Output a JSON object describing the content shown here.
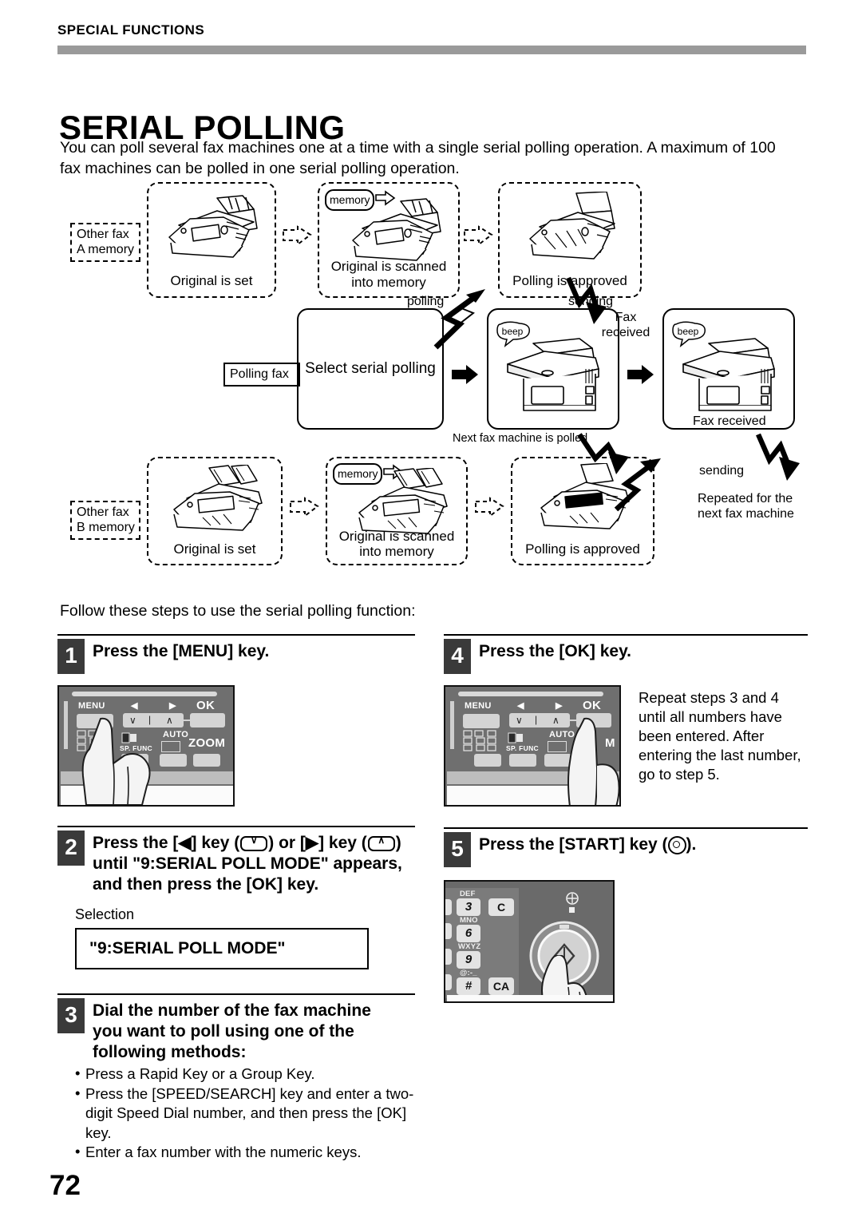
{
  "header": {
    "running_head": "SPECIAL FUNCTIONS"
  },
  "title": "SERIAL POLLING",
  "intro": "You can poll several fax machines one at a time with a single serial polling operation. A maximum of 100 fax machines can be polled in one serial polling operation.",
  "diagram": {
    "tag_other_fax_a": "Other fax A memory",
    "tag_other_fax_b": "Other fax B memory",
    "tag_polling_fax": "Polling fax",
    "a_original_set": "Original is set",
    "a_scanned": "Original is scanned\ninto memory",
    "a_scanned_line1": "Original is scanned",
    "a_scanned_line2": "into memory",
    "a_approved": "Polling is approved",
    "b_original_set": "Original is set",
    "b_scanned_line1": "Original is scanned",
    "b_scanned_line2": "into memory",
    "b_approved": "Polling is approved",
    "select_serial_polling": "Select serial polling",
    "memory_balloon": "memory",
    "beep_balloon": "beep",
    "label_polling": "polling",
    "label_sending_1": "sending",
    "label_sending_2": "sending",
    "label_fax_received_1_l1": "Fax",
    "label_fax_received_1_l2": "received",
    "label_fax_received_2": "Fax received",
    "label_next_polled": "Next fax machine is polled",
    "label_repeated_l1": "Repeated for the",
    "label_repeated_l2": "next fax machine"
  },
  "follow_line": "Follow these steps to use the serial polling function:",
  "steps": {
    "s1": {
      "num": "1",
      "title": "Press the [MENU] key."
    },
    "s2": {
      "num": "2",
      "title_a": "Press the [",
      "title_b": "] key (",
      "title_c": ") or [",
      "title_d": "] key (",
      "title_e": ")",
      "title_line2": "until \"9:SERIAL POLL MODE\" appears,",
      "title_line3": "and then press the [OK] key.",
      "selection_label": "Selection",
      "lcd_text": "\"9:SERIAL POLL MODE\""
    },
    "s3": {
      "num": "3",
      "title_line1": "Dial the number of the fax machine",
      "title_line2": "you want to poll using one of the",
      "title_line3": "following methods:",
      "bullets": [
        "Press a Rapid Key or a Group Key.",
        "Press the [SPEED/SEARCH] key and enter a two-digit Speed Dial number, and then press the [OK] key.",
        "Enter a fax number with the numeric keys."
      ]
    },
    "s4": {
      "num": "4",
      "title": "Press the [OK] key.",
      "note": "Repeat steps 3 and 4 until all numbers have been entered. After entering the last number, go to step 5."
    },
    "s5": {
      "num": "5",
      "title_a": "Press the  [START] key (",
      "title_b": ")."
    }
  },
  "panel_photo": {
    "menu": "MENU",
    "ok": "OK",
    "zoom": "ZOOM",
    "sp_func": "SP. FUNC",
    "auto": "AUTO",
    "z": "Z",
    "m": "M"
  },
  "numpad_photo": {
    "def": "DEF",
    "mno": "MNO",
    "wxyz": "WXYZ",
    "atsign": "@:-_",
    "k3": "3",
    "k6": "6",
    "k9": "9",
    "khash": "#",
    "kc": "C",
    "kca": "CA"
  },
  "page_number": "72",
  "colors": {
    "rule": "#9a9a9a",
    "step_badge": "#3a3a3a",
    "panel_bg": "#6f6f6f"
  }
}
